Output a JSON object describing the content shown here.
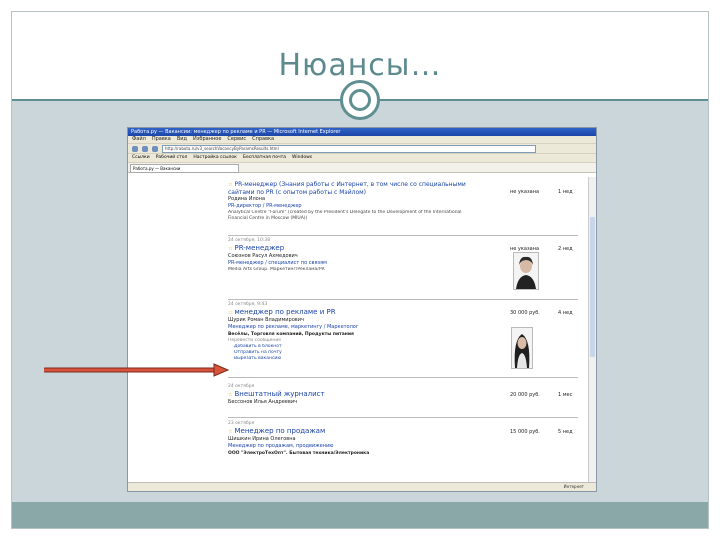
{
  "slide": {
    "title": "Нюансы…",
    "colors": {
      "title": "#5d8a8d",
      "accent": "#5f8f91",
      "band": "#cbd6da",
      "footer": "#8aa8a8",
      "arrow": "#d9533c"
    }
  },
  "browser": {
    "window_title": "Работа.ру — Вакансии: менеджер по рекламе и PR — Microsoft Internet Explorer",
    "menu": [
      "Файл",
      "Правка",
      "Вид",
      "Избранное",
      "Сервис",
      "Справка"
    ],
    "address": "http://rabota.ru/v3_searchVacancyByParamsResults.html",
    "links": [
      "Ссылки",
      "Рабочий стол",
      "Настройка ссылок",
      "Бесплатная почта",
      "Windows"
    ],
    "tab": "Работа.ру — Вакансии",
    "status": "Интернет",
    "listings": [
      {
        "date": "",
        "title": "PR-менеджер (Знания работы с Интернет, в том числе со специальными сайтами по PR (с опытом работы с Мэйлом)",
        "company": "Родина Илона",
        "line1": "PR-директор / PR-менеджер",
        "line2": "Analytical Centre \"Forum\" (created by the President's Delegate to the Development of the International Financial Centre in Moscow (MIUA))",
        "salary": "не указана",
        "ago": "1 нед"
      },
      {
        "date": "24 октября, 10:38",
        "title": "PR-менеджер",
        "company": "Союзнов Расул Ахмедович",
        "line1": "PR-менеджер / специалист по связям",
        "line2": "Media Arts Group. Маркетинг/Реклама/PR",
        "salary": "не указана",
        "ago": "2 нед"
      },
      {
        "date": "24 октября, 9:43",
        "title": "менеджер по рекламе и PR",
        "company": "Шурик Роман Владимирович",
        "line1": "Менеджер по рекламе, маркетингу / Маркетолог",
        "line2": "Весёлы, Торговля компаний, Продукты питания",
        "links": [
          "Перевести сообщение",
          "Добавить в блокнот",
          "Отправить на почту",
          "Вырезать вакансию"
        ],
        "salary": "30 000 руб.",
        "ago": "4 нед"
      },
      {
        "date": "24 октября",
        "title": "Внештатный журналист",
        "company": "Бессонов Илья Андреевич",
        "salary": "20 000 руб.",
        "ago": "1 мес"
      },
      {
        "date": "23 октября",
        "title": "Менеджер по продажам",
        "company": "Шишкин Ирина Олеговна",
        "line1": "Менеджер по продажам, продвижению",
        "line2": "ООО \"ЭлектроТехОпт\". Бытовая техника/Электроника",
        "salary": "15 000 руб.",
        "ago": "5 нед"
      }
    ]
  }
}
